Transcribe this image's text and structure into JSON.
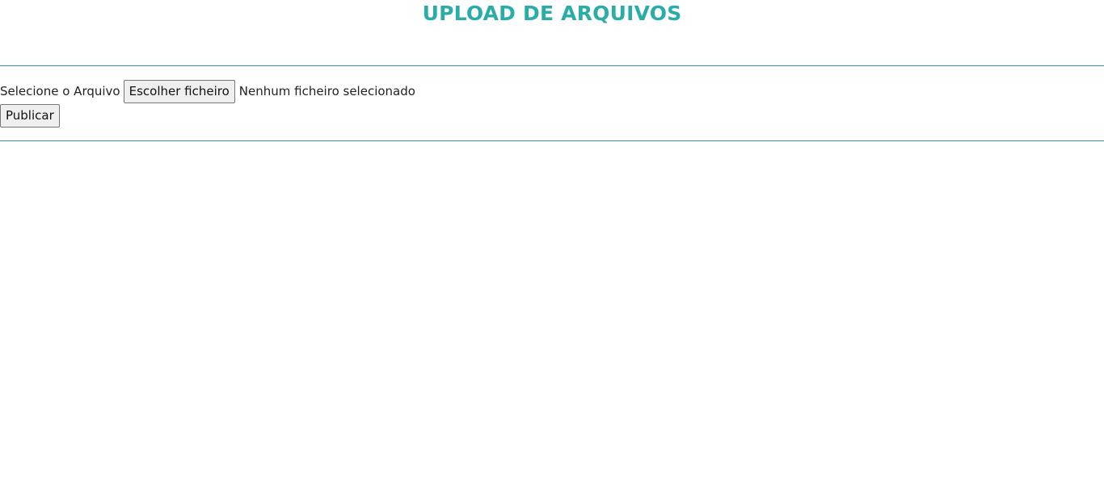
{
  "page": {
    "title": "UPLOAD DE ARQUIVOS",
    "accent_color": "#2aada8",
    "rule_color": "#2a9aa0"
  },
  "form": {
    "file_label": "Selecione o Arquivo",
    "choose_button_label": "Escolher ficheiro",
    "file_status": "Nenhum ficheiro selecionado",
    "submit_button_label": "Publicar"
  }
}
